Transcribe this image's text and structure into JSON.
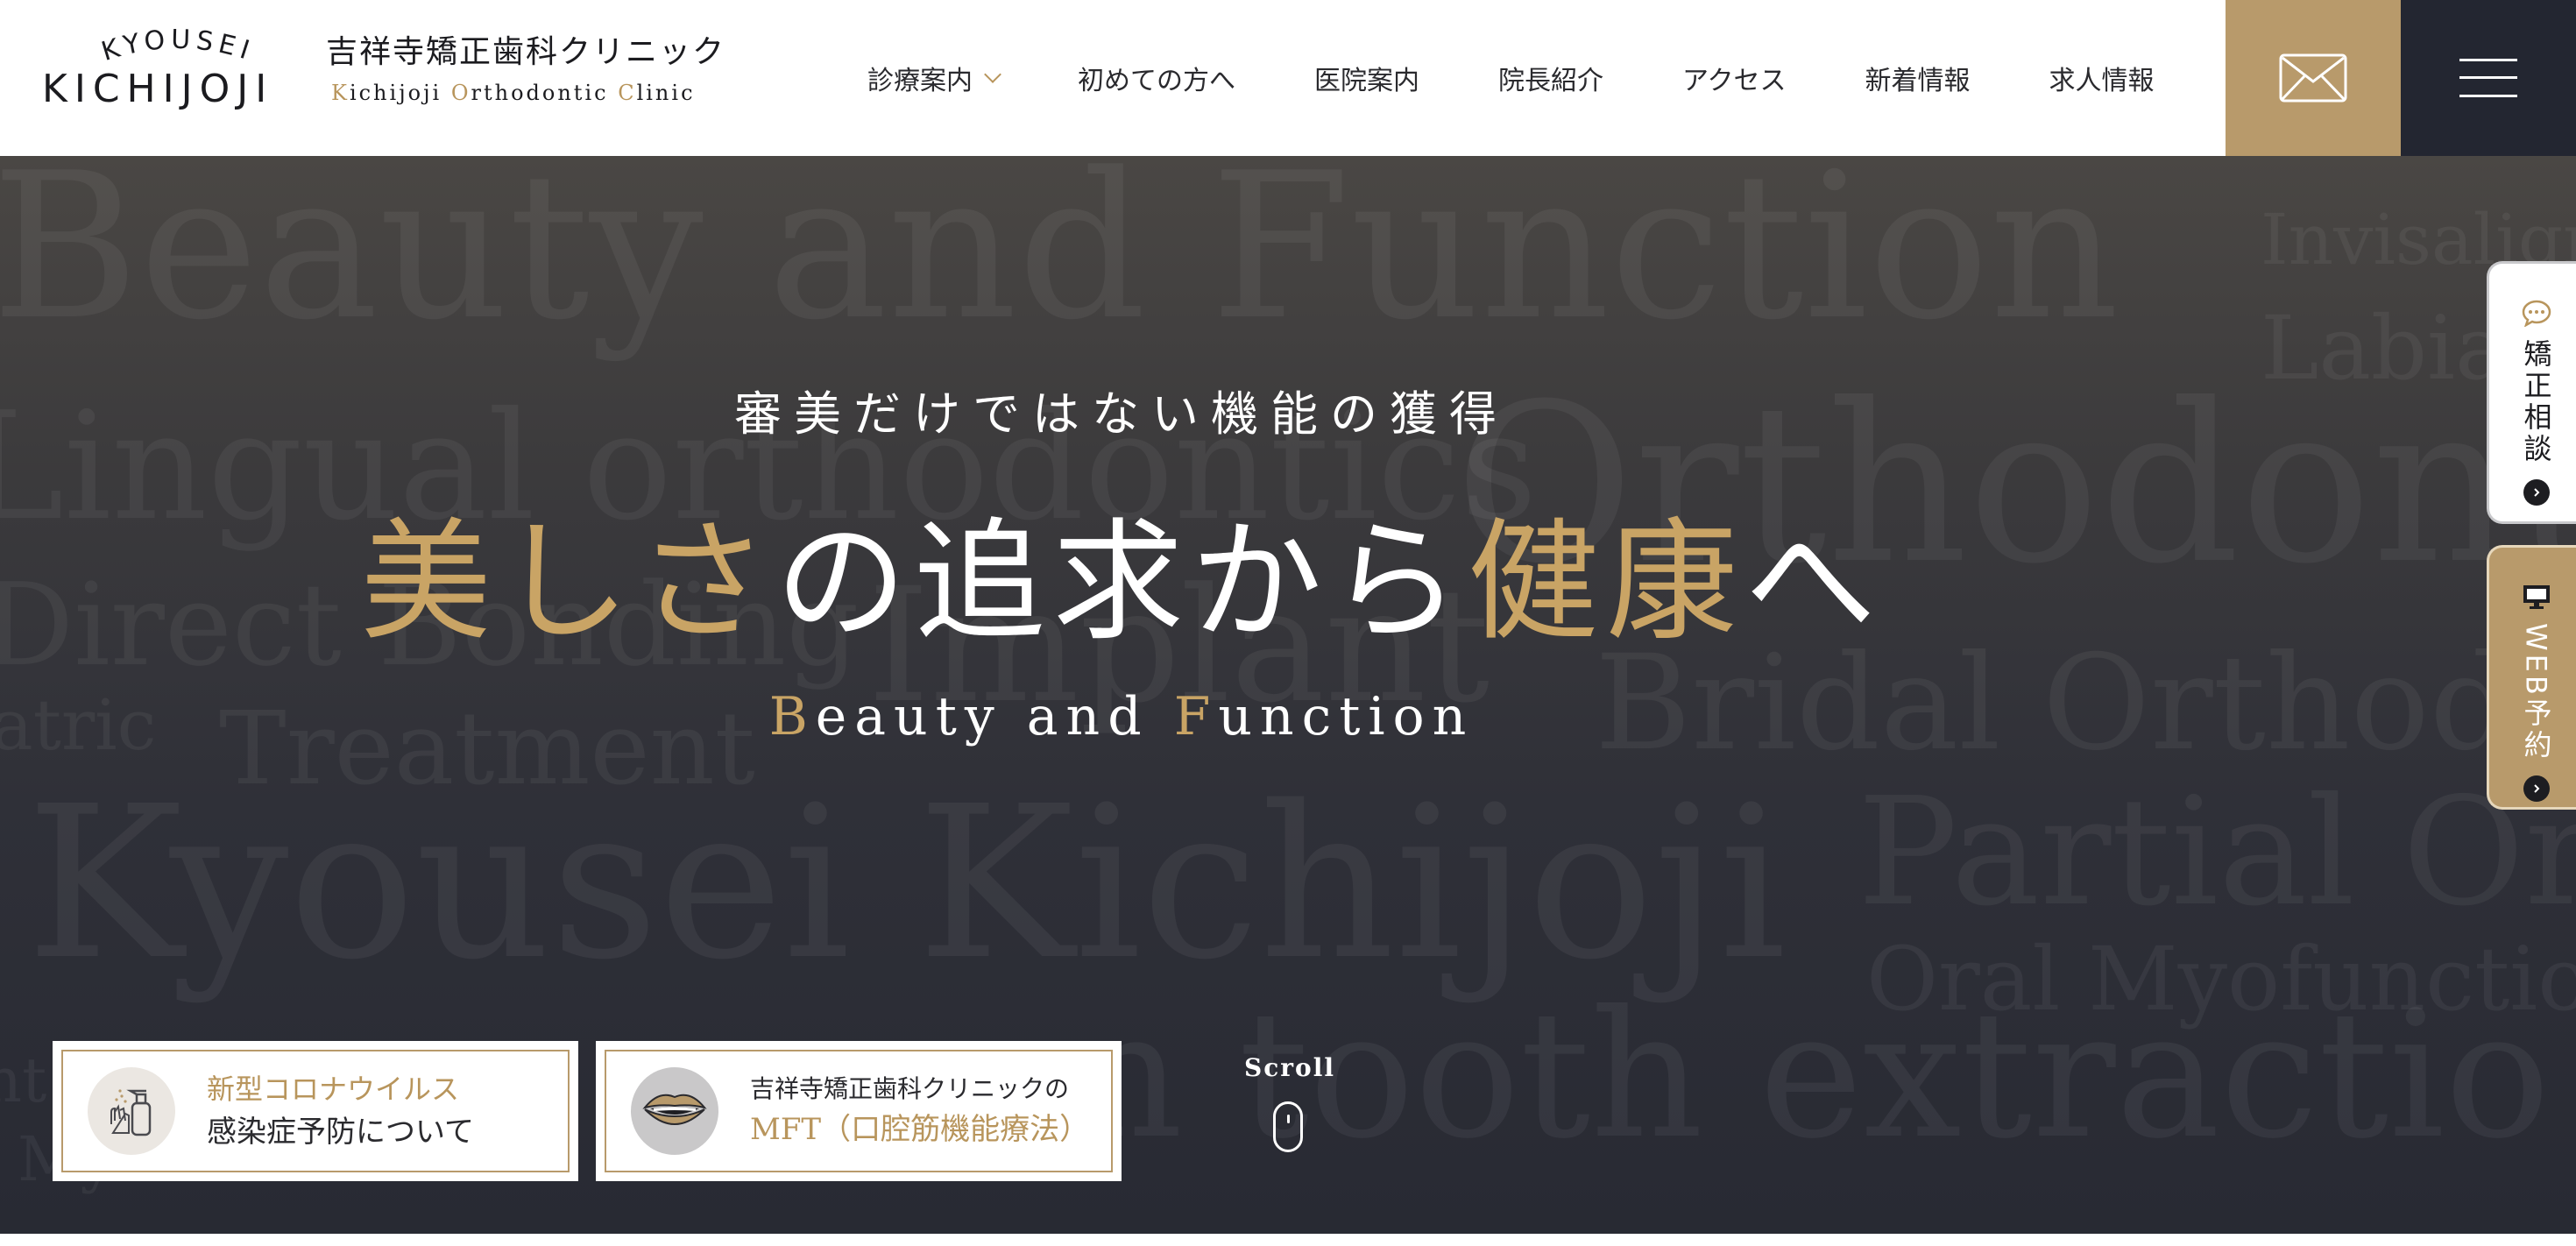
{
  "logo": {
    "arc_text": "KYOUSEI",
    "main_text": "KICHIJOJI",
    "jp_name": "吉祥寺矯正歯科クリニック",
    "en_name": {
      "k": "K",
      "ichijoji": "ichijoji ",
      "o": "O",
      "rthodontic": "rthodontic ",
      "c": "C",
      "linic": "linic"
    }
  },
  "nav": {
    "items": [
      "診療案内",
      "初めての方へ",
      "医院案内",
      "院長紹介",
      "アクセス",
      "新着情報",
      "求人情報"
    ]
  },
  "icons": {
    "mail": "mail-icon",
    "menu": "hamburger-menu-icon",
    "chat": "chat-bubble-icon",
    "monitor": "monitor-icon",
    "arrow": "chevron-right-icon",
    "covid": "sanitizer-icon",
    "mouth": "lips-mouth-icon",
    "scroll": "mouse-scroll-icon"
  },
  "hero": {
    "subtitle": "審美だけではない機能の獲得",
    "title": {
      "part1": "美しさ",
      "part2": "の追求から",
      "part3": "健康",
      "part4": "へ"
    },
    "en": {
      "b": "B",
      "eauty": "eauty and ",
      "f": "F",
      "unction": "unction"
    },
    "background_words": [
      "Beauty and Function",
      "Invisalign",
      "Labial",
      "Lingual orthodontics",
      "Orthodont",
      "Direct Bonding",
      "Implant",
      "atric",
      "Treatment",
      "Bridal Orthodo",
      "Kyousei Kichijoji",
      "Partial Or",
      "Oral Myofunctiona",
      "n",
      "om tooth extractio",
      "Myo",
      "nt"
    ]
  },
  "cards": {
    "covid": {
      "line1": "新型コロナウイルス",
      "line2": "感染症予防について"
    },
    "mft": {
      "line1": "吉祥寺矯正歯科クリニックの",
      "line2": "MFT（口腔筋機能療法）"
    }
  },
  "scroll": {
    "label": "Scroll"
  },
  "side_tabs": {
    "consult": "矯正相談",
    "web": "WEB予約"
  },
  "colors": {
    "gold": "#c9a465",
    "gold_button": "#b89a6b",
    "navy": "#232631",
    "text_dark": "#2a2a2e"
  }
}
